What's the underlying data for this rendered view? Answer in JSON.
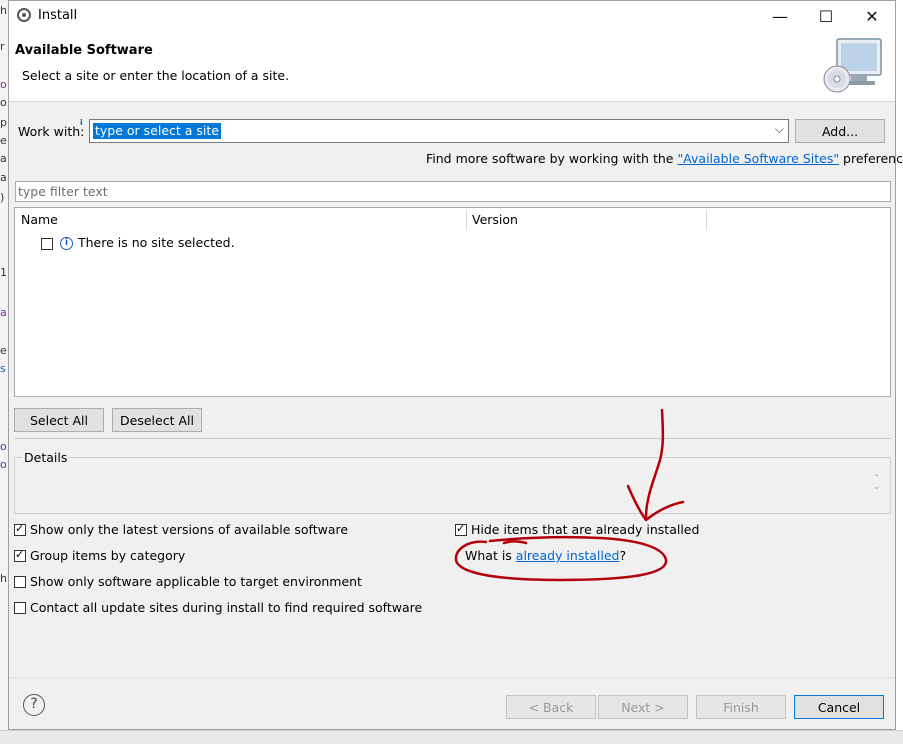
{
  "window": {
    "title": "Install",
    "minimize": "—",
    "maximize": "☐",
    "close": "✕"
  },
  "header": {
    "title": "Available Software",
    "description": "Select a site or enter the location of a site."
  },
  "work_with": {
    "label": "Work with:",
    "value": "type or select a site",
    "add_button": "Add..."
  },
  "find_more": {
    "prefix": "Find more software by working with the ",
    "link": "\"Available Software Sites\"",
    "suffix": " preferences."
  },
  "filter": {
    "placeholder": "type filter text"
  },
  "table": {
    "columns": [
      "Name",
      "Version"
    ],
    "rows": [
      {
        "name": "There is no site selected."
      }
    ]
  },
  "buttons": {
    "select_all": "Select All",
    "deselect_all": "Deselect All",
    "back": "< Back",
    "next": "Next >",
    "finish": "Finish",
    "cancel": "Cancel"
  },
  "details": {
    "label": "Details"
  },
  "options": {
    "latest_versions": {
      "label": "Show only the latest versions of available software",
      "checked": true
    },
    "group_by_category": {
      "label": "Group items by category",
      "checked": true
    },
    "target_environment": {
      "label": "Show only software applicable to target environment",
      "checked": false
    },
    "contact_all_sites": {
      "label": "Contact all update sites during install to find required software",
      "checked": false
    },
    "hide_installed": {
      "label": "Hide items that are already installed",
      "checked": true
    }
  },
  "what_is": {
    "prefix": "What is ",
    "link": "already installed",
    "suffix": "?"
  },
  "annotation": {
    "color": "#b3000c"
  },
  "colors": {
    "selection": "#0078d7",
    "link": "#0066cc"
  }
}
